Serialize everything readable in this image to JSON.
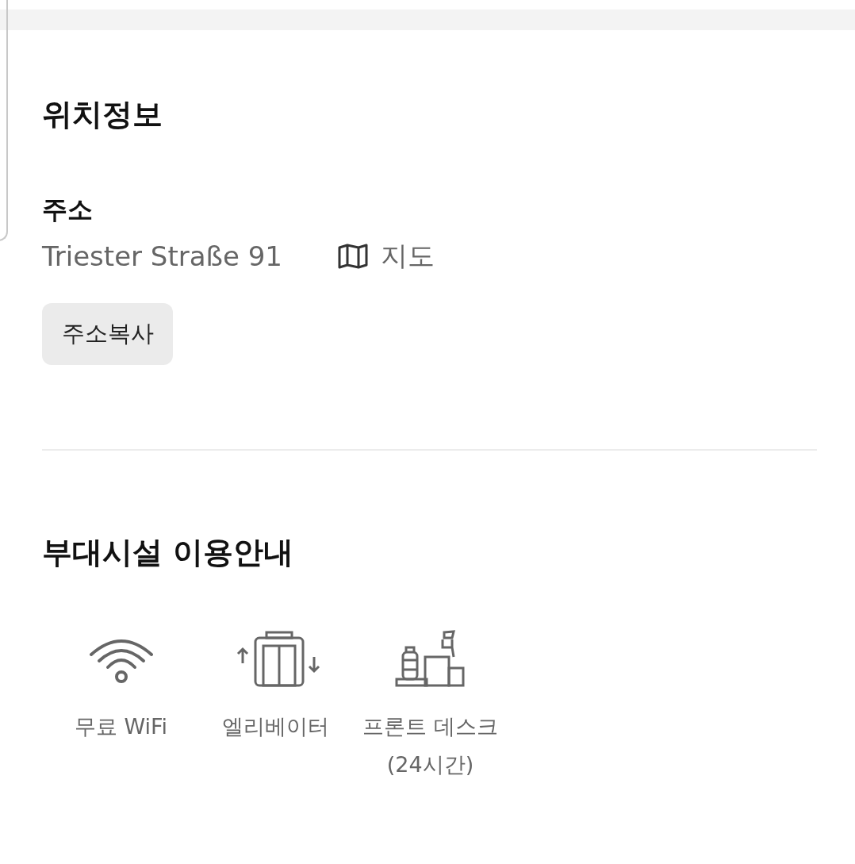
{
  "location": {
    "title": "위치정보",
    "address_label": "주소",
    "address": "Triester Straße 91",
    "map_link": "지도",
    "copy_button": "주소복사"
  },
  "facilities": {
    "title": "부대시설 이용안내",
    "items": [
      {
        "kind": "wifi",
        "label": "무료 WiFi"
      },
      {
        "kind": "elevator",
        "label": "엘리베이터"
      },
      {
        "kind": "front_desk",
        "label": "프론트 데스크 (24시간)"
      }
    ]
  }
}
